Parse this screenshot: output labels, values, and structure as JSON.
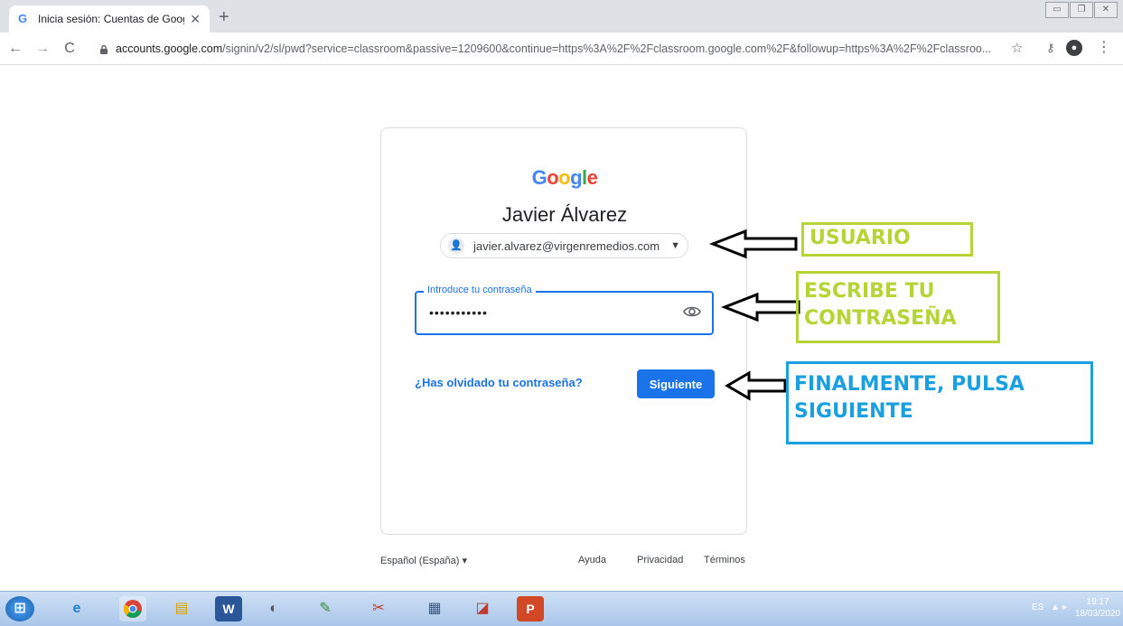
{
  "browser": {
    "tab_title": "Inicia sesión: Cuentas de Google",
    "tab_close": "✕",
    "new_tab": "+",
    "url_host": "accounts.google.com",
    "url_path": "/signin/v2/sl/pwd?service=classroom&passive=1209600&continue=https%3A%2F%2Fclassroom.google.com%2F&followup=https%3A%2F%2Fclassroo...",
    "icons": [
      "back-icon",
      "forward-icon",
      "reload-icon",
      "lock-icon",
      "star-icon",
      "key-icon",
      "profile-icon",
      "menu-icon"
    ]
  },
  "signin": {
    "logo": [
      "G",
      "o",
      "o",
      "g",
      "l",
      "e"
    ],
    "name": "Javier Álvarez",
    "email": "javier.alvarez@virgenremedios.com",
    "password_label": "Introduce tu contraseña",
    "password_value": "•••••••••••",
    "forgot_link": "¿Has olvidado tu contraseña?",
    "next_button": "Siguiente"
  },
  "footer": {
    "language": "Español (España)",
    "help": "Ayuda",
    "privacy": "Privacidad",
    "terms": "Términos"
  },
  "annotations": {
    "user": "USUARIO",
    "password_line1": "ESCRIBE TU",
    "password_line2": "CONTRASEÑA",
    "next_line1": "FINALMENTE, PULSA",
    "next_line2": "SIGUIENTE",
    "green": "#b5d435",
    "blue": "#1a9fe0"
  },
  "taskbar": {
    "language": "ES",
    "time": "19:17",
    "date": "18/03/2020"
  }
}
